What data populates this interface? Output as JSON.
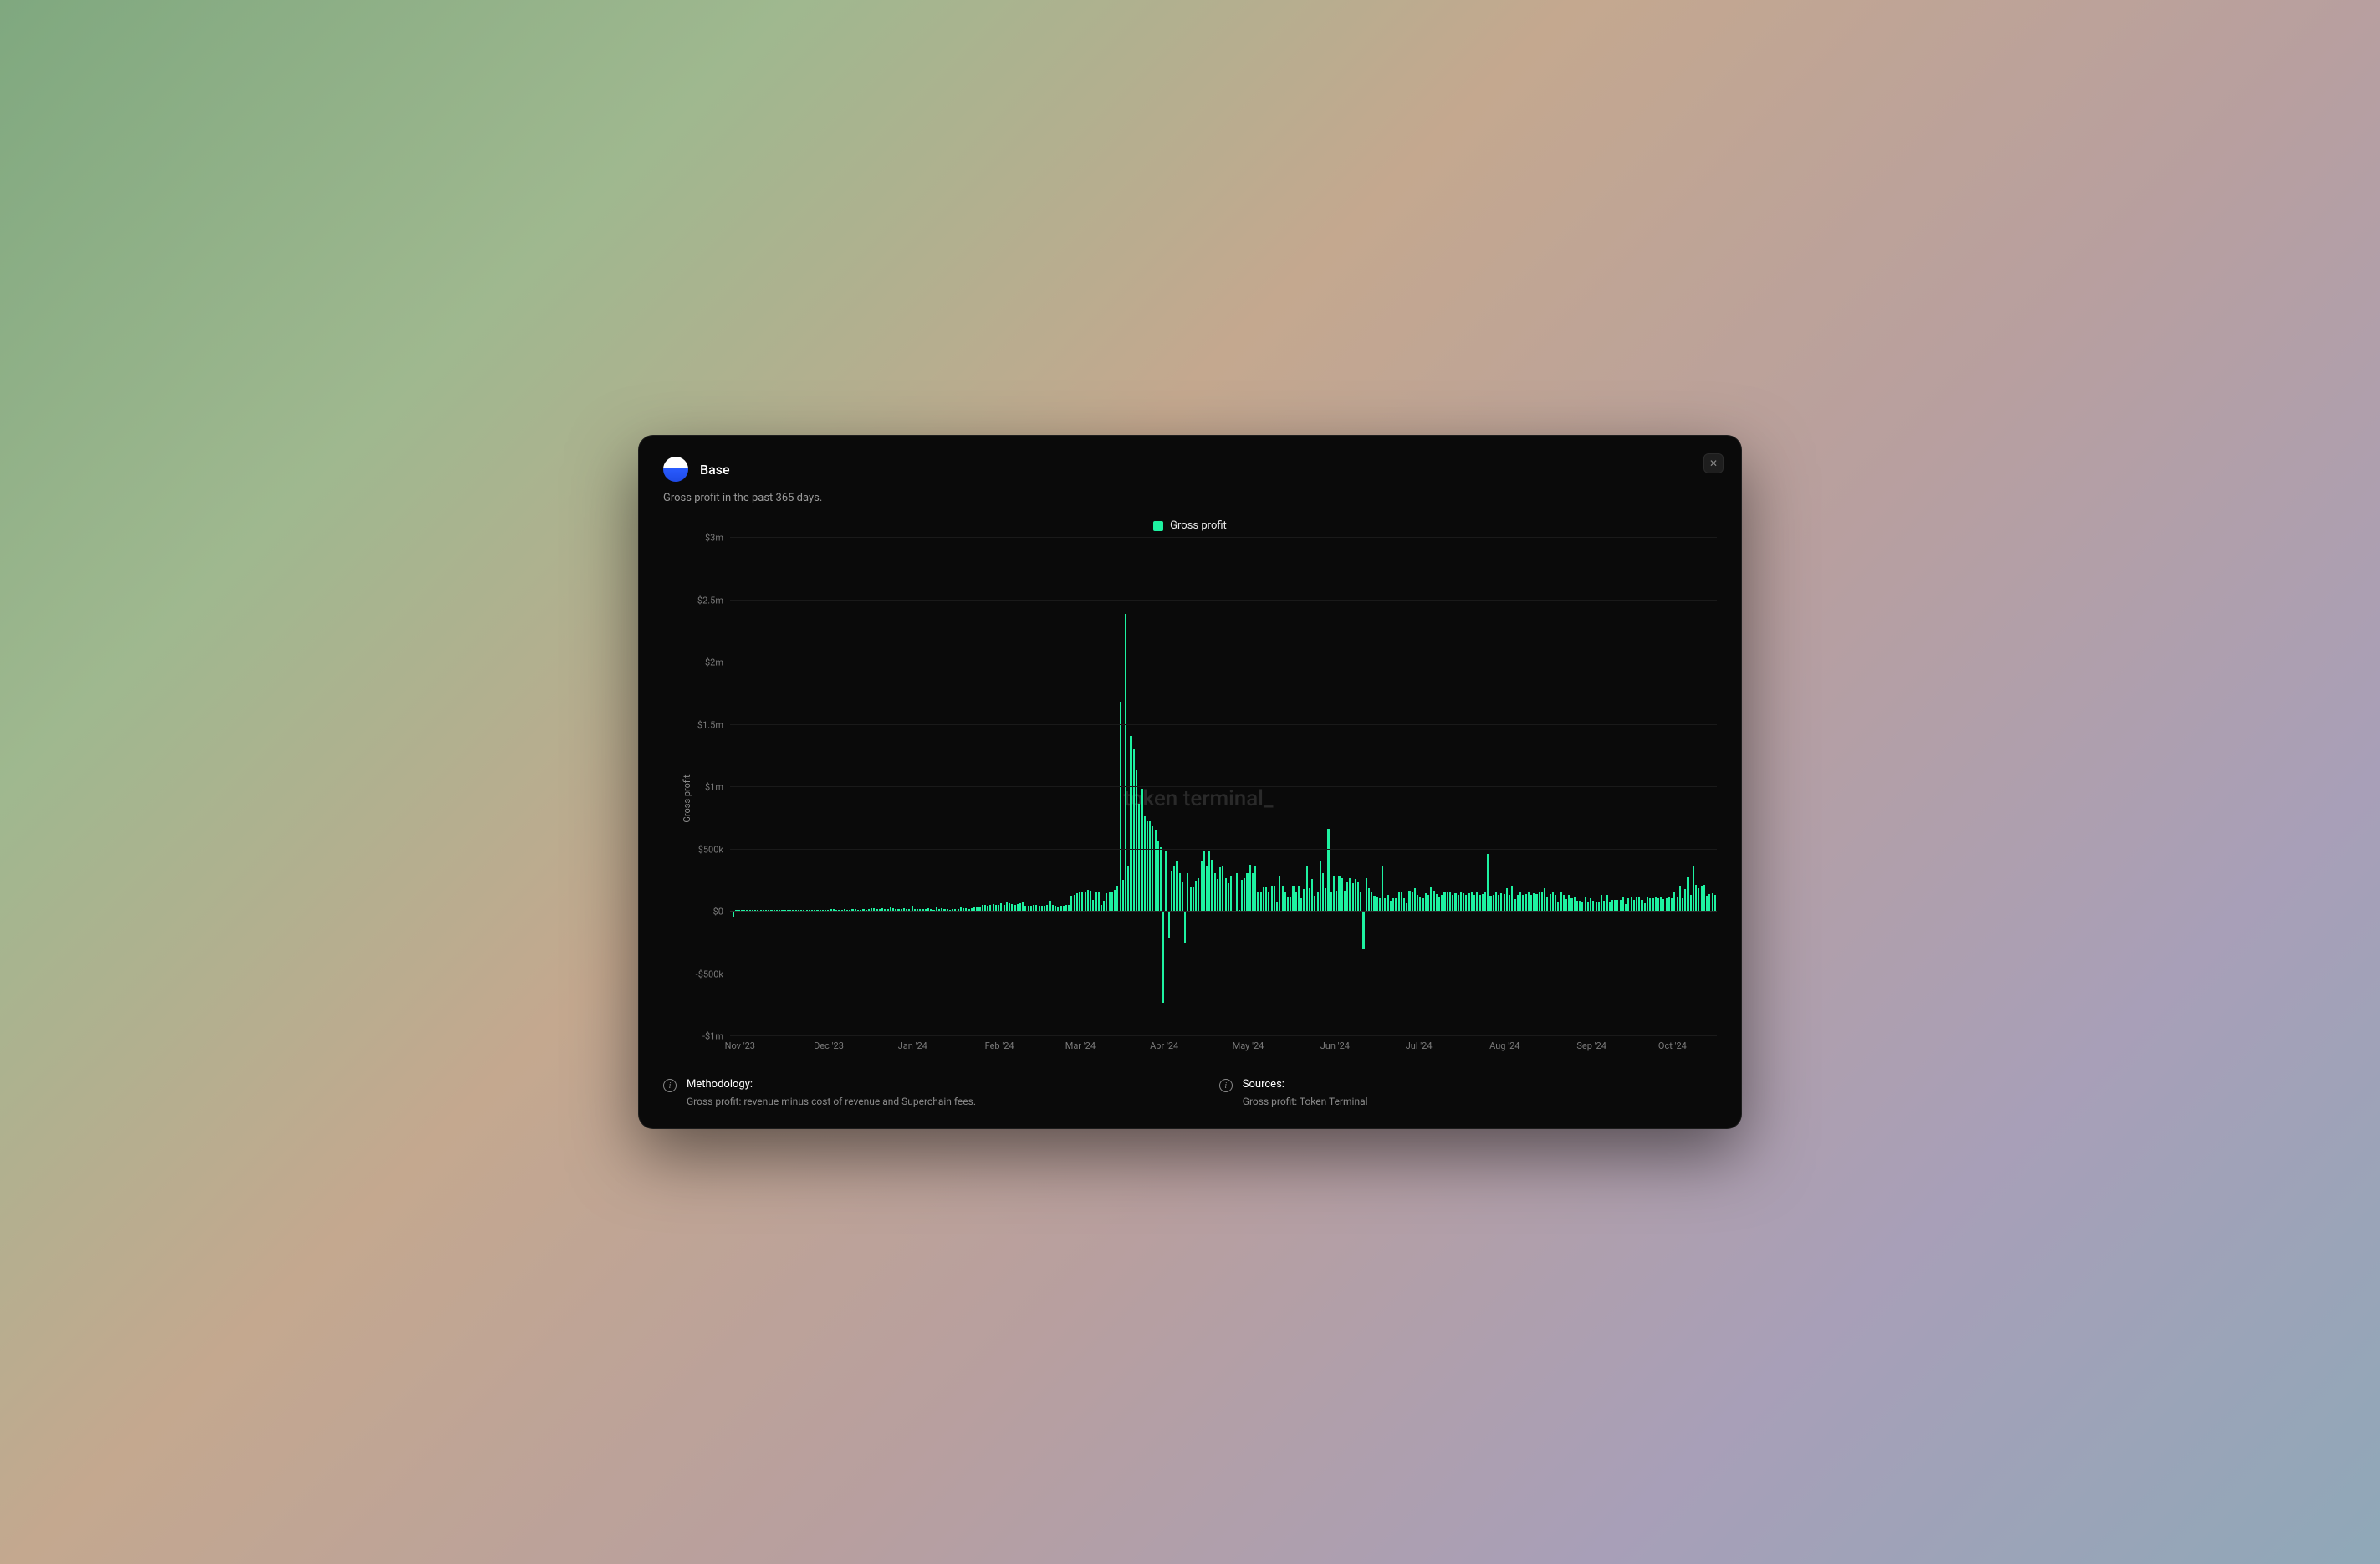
{
  "header": {
    "title": "Base",
    "subtitle": "Gross profit in the past 365 days."
  },
  "legend": {
    "label": "Gross profit"
  },
  "watermark": "token terminal_",
  "y_axis_label": "Gross profit",
  "footer": {
    "methodology_title": "Methodology:",
    "methodology_text": "Gross profit: revenue minus cost of revenue and Superchain fees.",
    "sources_title": "Sources:",
    "sources_text": "Gross profit: Token Terminal"
  },
  "chart_data": {
    "type": "bar",
    "title": "Gross profit in the past 365 days.",
    "xlabel": "",
    "ylabel": "Gross profit",
    "series_name": "Gross profit",
    "color": "#1ef2a1",
    "ylim": [
      -1000000,
      3000000
    ],
    "y_ticks": [
      {
        "v": 3000000,
        "label": "$3m"
      },
      {
        "v": 2500000,
        "label": "$2.5m"
      },
      {
        "v": 2000000,
        "label": "$2m"
      },
      {
        "v": 1500000,
        "label": "$1.5m"
      },
      {
        "v": 1000000,
        "label": "$1m"
      },
      {
        "v": 500000,
        "label": "$500k"
      },
      {
        "v": 0,
        "label": "$0"
      },
      {
        "v": -500000,
        "label": "-$500k"
      },
      {
        "v": -1000000,
        "label": "-$1m"
      }
    ],
    "x_ticks": [
      {
        "pos": 0.01,
        "label": "Nov '23"
      },
      {
        "pos": 0.1,
        "label": "Dec '23"
      },
      {
        "pos": 0.185,
        "label": "Jan '24"
      },
      {
        "pos": 0.273,
        "label": "Feb '24"
      },
      {
        "pos": 0.355,
        "label": "Mar '24"
      },
      {
        "pos": 0.44,
        "label": "Apr '24"
      },
      {
        "pos": 0.525,
        "label": "May '24"
      },
      {
        "pos": 0.613,
        "label": "Jun '24"
      },
      {
        "pos": 0.698,
        "label": "Jul '24"
      },
      {
        "pos": 0.785,
        "label": "Aug '24"
      },
      {
        "pos": 0.873,
        "label": "Sep '24"
      },
      {
        "pos": 0.955,
        "label": "Oct '24"
      }
    ],
    "values": [
      2000,
      -55000,
      8000,
      6000,
      5000,
      7000,
      6000,
      6000,
      5000,
      6000,
      6000,
      5000,
      6000,
      4000,
      5000,
      8000,
      10000,
      5000,
      6000,
      7000,
      6000,
      7000,
      6000,
      6000,
      8000,
      7000,
      6000,
      7000,
      6000,
      6000,
      8000,
      7000,
      6000,
      7000,
      8000,
      7000,
      6000,
      11000,
      12000,
      10000,
      9000,
      8000,
      11000,
      9000,
      10000,
      12000,
      11000,
      10000,
      9000,
      12000,
      10000,
      15000,
      22000,
      18000,
      12000,
      11000,
      20000,
      15000,
      13000,
      28000,
      18000,
      14000,
      12000,
      11000,
      18000,
      15000,
      12000,
      38000,
      14000,
      12000,
      11000,
      12000,
      15000,
      18000,
      11000,
      10000,
      25000,
      15000,
      18000,
      12000,
      13000,
      10000,
      15000,
      12000,
      11000,
      32000,
      22000,
      18000,
      15000,
      22000,
      28000,
      30000,
      35000,
      45000,
      50000,
      40000,
      45000,
      55000,
      48000,
      45000,
      60000,
      50000,
      65000,
      60000,
      55000,
      45000,
      55000,
      60000,
      65000,
      42000,
      38000,
      40000,
      45000,
      48000,
      40000,
      38000,
      42000,
      45000,
      80000,
      50000,
      40000,
      32000,
      38000,
      42000,
      48000,
      45000,
      120000,
      130000,
      140000,
      150000,
      155000,
      148000,
      165000,
      160000,
      90000,
      145000,
      150000,
      50000,
      80000,
      140000,
      150000,
      145000,
      165000,
      200000,
      1680000,
      250000,
      2380000,
      360000,
      1400000,
      1300000,
      1130000,
      860000,
      980000,
      760000,
      720000,
      720000,
      680000,
      650000,
      560000,
      510000,
      -740000,
      480000,
      -220000,
      320000,
      360000,
      395000,
      305000,
      225000,
      -260000,
      305000,
      190000,
      195000,
      240000,
      260000,
      400000,
      480000,
      355000,
      480000,
      410000,
      300000,
      255000,
      350000,
      360000,
      260000,
      220000,
      280000,
      2000,
      300000,
      6000,
      250000,
      260000,
      300000,
      370000,
      300000,
      360000,
      155000,
      150000,
      190000,
      195000,
      150000,
      200000,
      200000,
      65000,
      280000,
      200000,
      155000,
      110000,
      115000,
      200000,
      145000,
      200000,
      100000,
      175000,
      355000,
      180000,
      255000,
      120000,
      150000,
      400000,
      305000,
      180000,
      660000,
      155000,
      280000,
      160000,
      280000,
      260000,
      160000,
      230000,
      260000,
      220000,
      255000,
      225000,
      155000,
      -310000,
      260000,
      180000,
      155000,
      120000,
      110000,
      100000,
      355000,
      100000,
      125000,
      80000,
      100000,
      100000,
      155000,
      155000,
      100000,
      60000,
      160000,
      155000,
      180000,
      130000,
      115000,
      100000,
      140000,
      130000,
      190000,
      160000,
      135000,
      110000,
      130000,
      150000,
      150000,
      155000,
      130000,
      140000,
      125000,
      150000,
      140000,
      130000,
      140000,
      150000,
      130000,
      145000,
      130000,
      135000,
      150000,
      455000,
      120000,
      130000,
      145000,
      130000,
      140000,
      135000,
      180000,
      130000,
      200000,
      95000,
      130000,
      150000,
      125000,
      135000,
      145000,
      130000,
      140000,
      135000,
      145000,
      150000,
      180000,
      110000,
      135000,
      145000,
      130000,
      70000,
      145000,
      130000,
      95000,
      130000,
      100000,
      110000,
      80000,
      78000,
      75000,
      110000,
      75000,
      100000,
      80000,
      75000,
      70000,
      130000,
      80000,
      125000,
      70000,
      85000,
      90000,
      90000,
      90000,
      105000,
      55000,
      100000,
      105000,
      90000,
      110000,
      105000,
      85000,
      60000,
      110000,
      100000,
      100000,
      110000,
      100000,
      105000,
      95000,
      100000,
      110000,
      100000,
      150000,
      105000,
      200000,
      100000,
      175000,
      275000,
      130000,
      360000,
      210000,
      180000,
      200000,
      210000,
      120000,
      135000,
      140000,
      130000
    ]
  }
}
